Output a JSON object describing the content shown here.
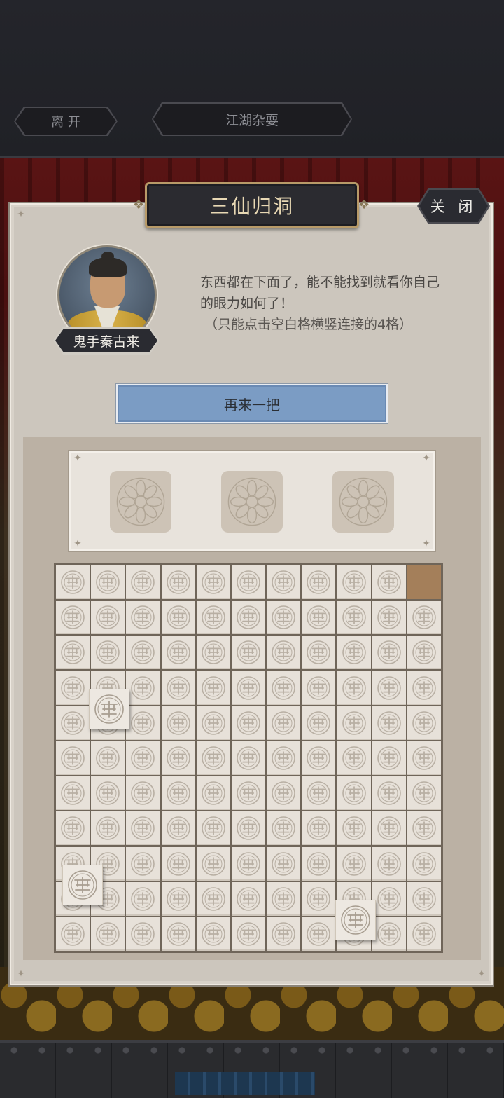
{
  "top_bar": {
    "leave_label": "离 开",
    "title_label": "江湖杂耍"
  },
  "panel": {
    "title": "三仙归洞",
    "close_label": "关 闭"
  },
  "npc": {
    "name": "鬼手秦古来",
    "dialog_line1": "东西都在下面了，能不能找到就看你自己",
    "dialog_line2": "的眼力如何了！",
    "dialog_hint": "（只能点击空白格横竖连接的4格）"
  },
  "retry_button": {
    "label": "再来一把"
  },
  "slots": {
    "count": 3
  },
  "grid": {
    "rows": 11,
    "cols": 11,
    "empty_cells": [
      [
        0,
        10
      ]
    ],
    "floating_tiles": [
      {
        "row": 3,
        "col": 1
      },
      {
        "row": 8,
        "col": 0
      },
      {
        "row": 9,
        "col": 8
      }
    ]
  },
  "colors": {
    "panel_bg": "#ccc6bd",
    "button_blue": "#7b9cc4",
    "tile": "#e7e1d9",
    "empty_tile": "#a47f5a",
    "title_gold": "#e8d8b4"
  },
  "icons": {
    "tile_pattern": "shou-symbol-icon",
    "slot_pattern": "floral-medallion-icon"
  }
}
